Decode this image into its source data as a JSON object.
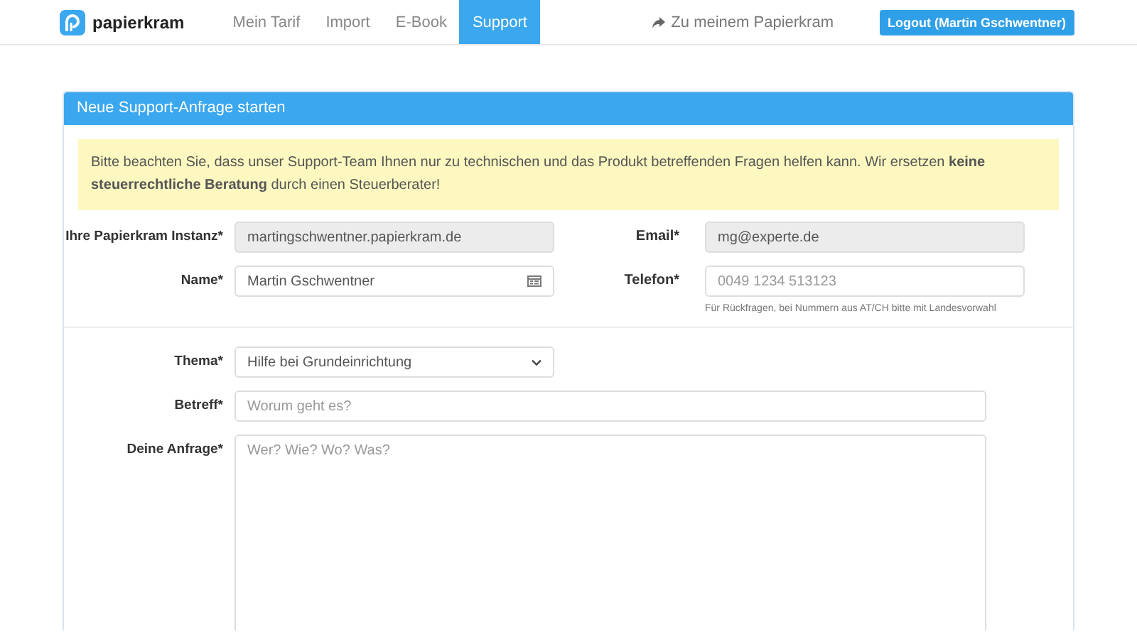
{
  "nav": {
    "brand": "papierkram",
    "items": [
      {
        "label": "Mein Tarif",
        "selected": false
      },
      {
        "label": "Import",
        "selected": false
      },
      {
        "label": "E-Book",
        "selected": false
      },
      {
        "label": "Support",
        "selected": true
      }
    ],
    "link": "Zu meinem Papierkram",
    "logout": "Logout (Martin Gschwentner)"
  },
  "panel": {
    "title": "Neue Support-Anfrage starten",
    "notice": "Bitte beachten Sie, dass unser Support-Team Ihnen nur zu technischen und das Produkt betreffenden Fragen helfen kann. Wir ersetzen **keine steuerrechtliche Beratung** durch einen Steuerberater!",
    "top_rows": [
      [
        {
          "label": "Ihre Papierkram Instanz*",
          "value": "martingschwentner.papierkram.de",
          "disabled": true
        },
        {
          "label": "Email*",
          "value": "mg@experte.de",
          "disabled": true
        }
      ],
      [
        {
          "label": "Name*",
          "value": "Martin Gschwentner",
          "disabled": false,
          "card_icon": true
        },
        {
          "label": "Telefon*",
          "placeholder": "0049 1234 513123",
          "disabled": false,
          "help": "Für Rückfragen, bei Nummern aus AT/CH bitte mit Landesvorwahl"
        }
      ]
    ],
    "fields": [
      {
        "kind": "select",
        "label": "Thema*",
        "value": "Hilfe bei Grundeinrichtung"
      },
      {
        "kind": "text",
        "label": "Betreff*",
        "placeholder": "Worum geht es?"
      },
      {
        "kind": "textarea",
        "label": "Deine Anfrage*",
        "placeholder": "Wer? Wie? Wo? Was?"
      }
    ]
  }
}
